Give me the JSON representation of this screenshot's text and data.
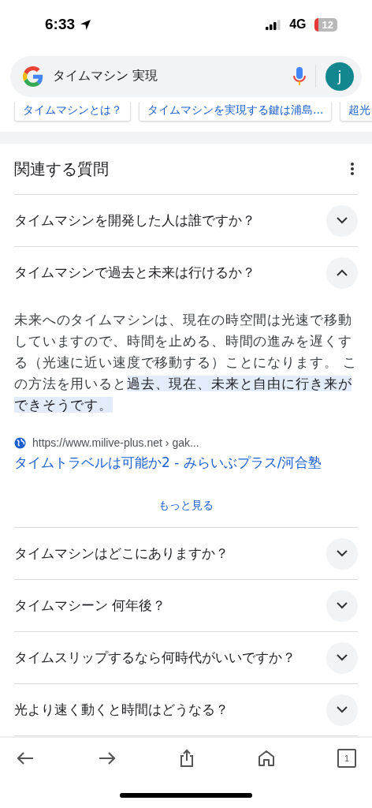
{
  "status_bar": {
    "time": "6:33",
    "network": "4G",
    "battery": "12"
  },
  "search": {
    "query": "タイムマシン 実現",
    "avatar": "j"
  },
  "chips": [
    "タイムマシンとは？",
    "タイムマシンを実現する鍵は浦島...",
    "超光"
  ],
  "related": {
    "title": "関連する質問",
    "questions": [
      {
        "text": "タイムマシンを開発した人は誰ですか？",
        "expanded": false
      },
      {
        "text": "タイムマシンで過去と未来は行けるか？",
        "expanded": true,
        "answer": {
          "text": "未来へのタイムマシンは、現在の時空間は光速で移動していますので、時間を止める、時間の進みを遅くする（光速に近い速度で移動する）ことになります。 この方法を用いると",
          "highlight": "過去、現在、未来と自由に行き来ができそうです。"
        },
        "source_url": "https://www.milive-plus.net › gak...",
        "source_title": "タイムトラベルは可能か2 - みらいぶプラス/河合塾",
        "more": "もっと見る"
      },
      {
        "text": "タイムマシンはどこにありますか？",
        "expanded": false
      },
      {
        "text": "タイムマシーン 何年後？",
        "expanded": false
      },
      {
        "text": "タイムスリップするなら何時代がいいですか？",
        "expanded": false
      },
      {
        "text": "光より速く動くと時間はどうなる？",
        "expanded": false
      }
    ]
  },
  "toolbar": {
    "tabs": "1"
  }
}
